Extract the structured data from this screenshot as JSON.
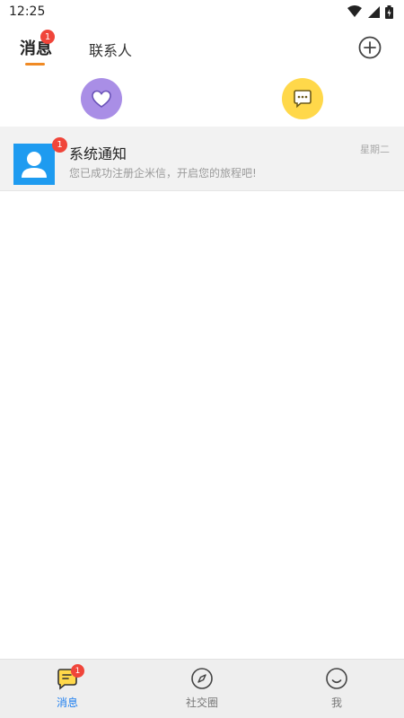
{
  "status_bar": {
    "time": "12:25"
  },
  "tabs": {
    "messages": {
      "label": "消息",
      "badge": "1"
    },
    "contacts": {
      "label": "联系人"
    }
  },
  "conversation": {
    "title": "系统通知",
    "badge": "1",
    "preview": "您已成功注册企米信，开启您的旅程吧!",
    "time": "星期二"
  },
  "bottom_nav": {
    "messages": {
      "label": "消息",
      "badge": "1"
    },
    "social": {
      "label": "社交圈"
    },
    "me": {
      "label": "我"
    }
  },
  "colors": {
    "accent_orange": "#f08a24",
    "active_blue": "#1e7ff0",
    "badge_red": "#f0453a",
    "avatar_blue": "#1e9bf0",
    "like_purple": "#a98ee6",
    "chat_yellow": "#ffd84a"
  },
  "icons": [
    "wifi-icon",
    "signal-icon",
    "battery-icon",
    "add-circle-icon",
    "heart-icon",
    "chat-bubble-icon",
    "user-icon",
    "message-tab-icon",
    "compass-icon",
    "smile-icon"
  ]
}
